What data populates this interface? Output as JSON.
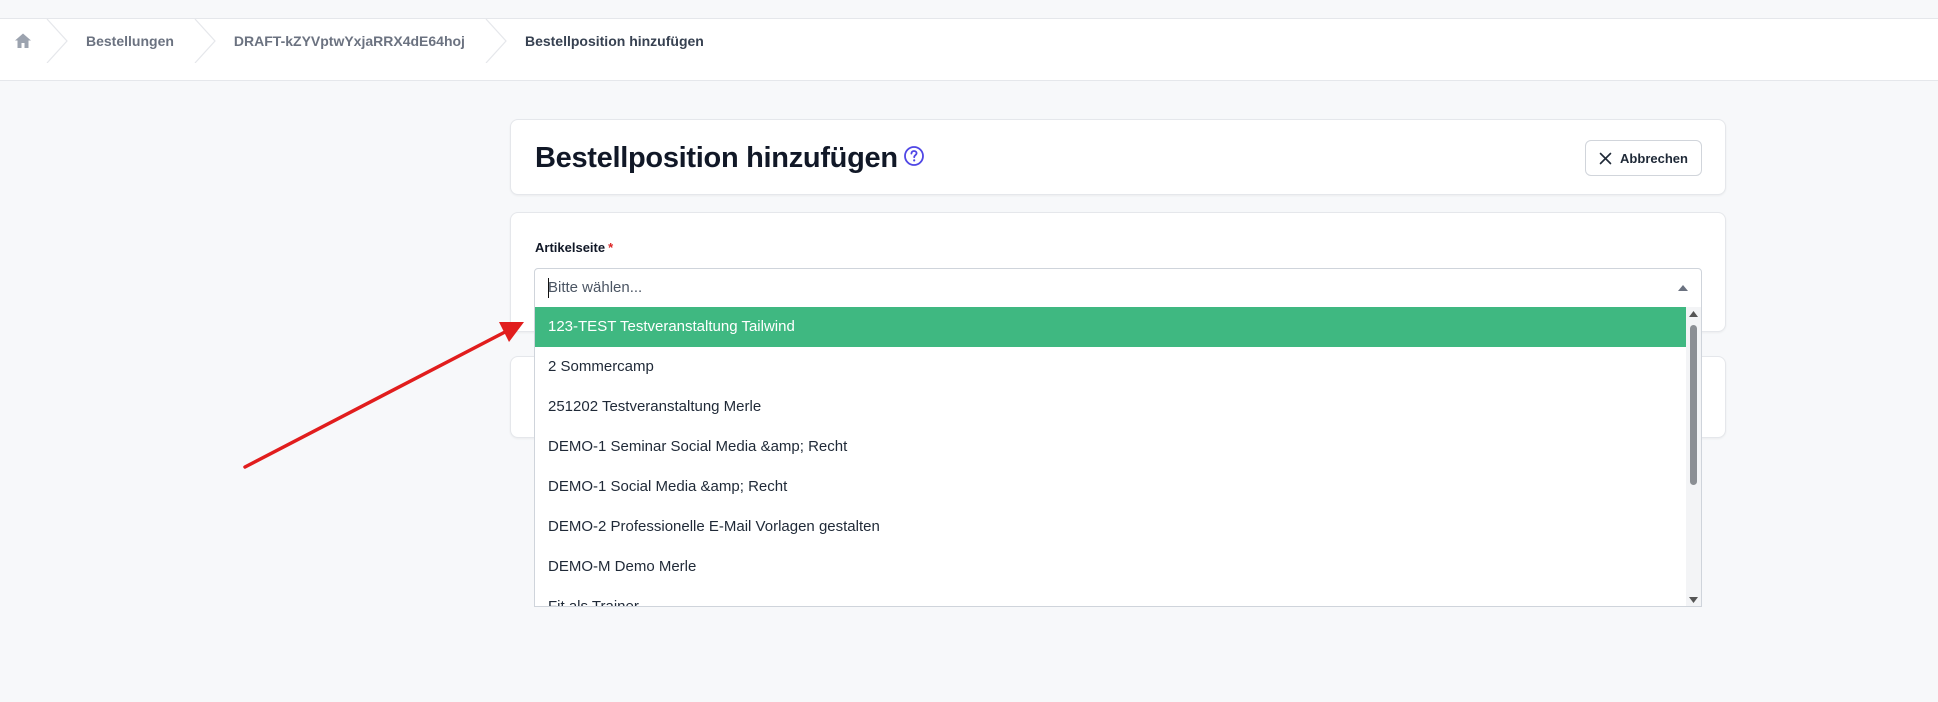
{
  "breadcrumb": {
    "home_icon": "home-icon",
    "items": [
      "Bestellungen",
      "DRAFT-kZYVptwYxjaRRX4dE64hoj",
      "Bestellposition hinzufügen"
    ]
  },
  "header": {
    "title": "Bestellposition hinzufügen",
    "help_icon": "help-circle-icon",
    "cancel_label": "Abbrechen",
    "cancel_icon": "close-icon"
  },
  "form": {
    "field_label": "Artikelseite",
    "required_marker": "*",
    "select_placeholder": "Bitte wählen...",
    "options": [
      "123-TEST Testveranstaltung Tailwind",
      "2 Sommercamp",
      "251202 Testveranstaltung Merle",
      "DEMO-1 Seminar Social Media &amp; Recht",
      "DEMO-1 Social Media &amp; Recht",
      "DEMO-2 Professionelle E-Mail Vorlagen gestalten",
      "DEMO-M Demo Merle",
      "Fit als Trainer"
    ],
    "highlighted_index": 0
  },
  "colors": {
    "highlight": "#3fb881",
    "arrow": "#e11d1d",
    "help_icon": "#4f46e5",
    "required": "#dc2626"
  }
}
